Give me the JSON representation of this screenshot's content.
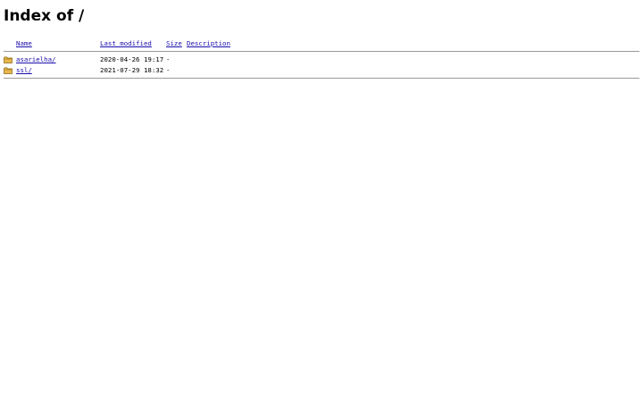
{
  "page": {
    "title": "Index of /"
  },
  "table": {
    "headers": {
      "name": "Name",
      "last_modified": "Last modified",
      "size": "Size",
      "description": "Description"
    },
    "rows": [
      {
        "icon": "folder-icon",
        "name": "asarielha/",
        "modified": "2020-04-26 19:17",
        "size": "-",
        "description": ""
      },
      {
        "icon": "folder-icon",
        "name": "ssl/",
        "modified": "2021-07-29 18:32",
        "size": "-",
        "description": ""
      }
    ]
  },
  "colors": {
    "link": "#1a0dab",
    "folder": "#e8b74a",
    "separator": "#9a9a9a"
  }
}
